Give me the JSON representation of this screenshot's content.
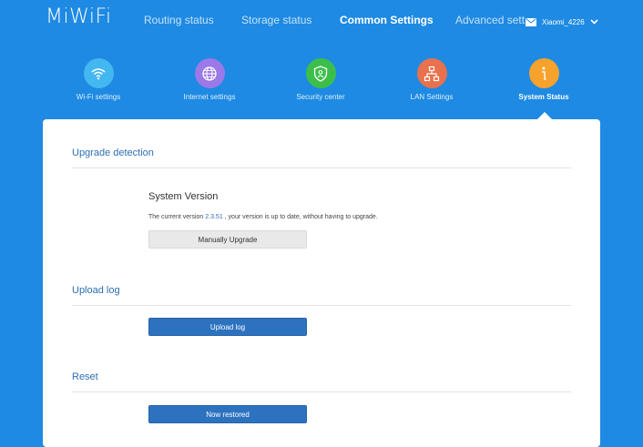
{
  "header": {
    "logo": "MiWiFi",
    "nav": [
      {
        "label": "Routing status"
      },
      {
        "label": "Storage status"
      },
      {
        "label": "Common Settings",
        "active": true
      },
      {
        "label": "Advanced settings"
      }
    ],
    "user": {
      "name": "Xiaomi_4226",
      "mail_icon": "mail-icon",
      "dropdown_icon": "chevron-down-icon"
    }
  },
  "tiles": [
    {
      "label": "Wi-Fi settings",
      "icon": "wifi-icon",
      "color": "#43b7f0"
    },
    {
      "label": "Internet settings",
      "icon": "globe-icon",
      "color": "#9b79e8"
    },
    {
      "label": "Security center",
      "icon": "shield-icon",
      "color": "#3cbf4a"
    },
    {
      "label": "LAN Settings",
      "icon": "network-icon",
      "color": "#e9714d"
    },
    {
      "label": "System Status",
      "icon": "info-icon",
      "color": "#f7a22c",
      "active": true
    }
  ],
  "panel": {
    "upgrade": {
      "title": "Upgrade detection",
      "version_heading": "System Version",
      "text_before": "The current version ",
      "version": "2.3.51",
      "text_after": " , your version is up to date, without having to upgrade.",
      "button": "Manually Upgrade"
    },
    "upload": {
      "title": "Upload log",
      "button": "Upload log"
    },
    "reset": {
      "title": "Reset",
      "button": "Now restored"
    }
  }
}
